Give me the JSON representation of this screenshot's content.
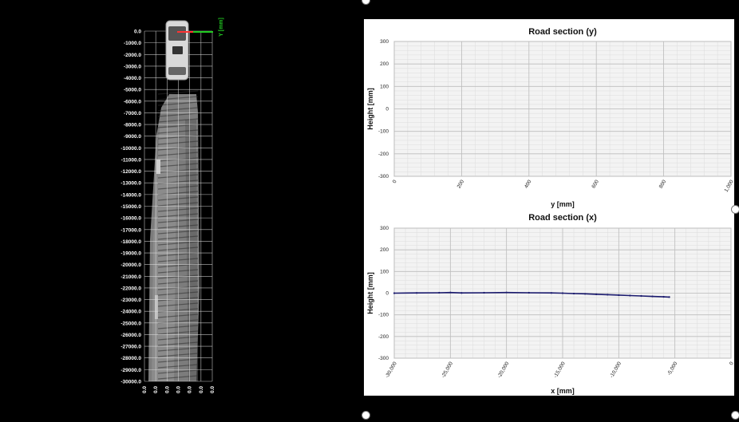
{
  "scan_view": {
    "axis_label": "Y [mm]",
    "row_labels": [
      "0.0",
      "-1000.0",
      "-2000.0",
      "-3000.0",
      "-4000.0",
      "-5000.0",
      "-6000.0",
      "-7000.0",
      "-8000.0",
      "-9000.0",
      "-10000.0",
      "-11000.0",
      "-12000.0",
      "-13000.0",
      "-14000.0",
      "-15000.0",
      "-16000.0",
      "-17000.0",
      "-18000.0",
      "-19000.0",
      "-20000.0",
      "-21000.0",
      "-22000.0",
      "-23000.0",
      "-24000.0",
      "-25000.0",
      "-26000.0",
      "-27000.0",
      "-28000.0",
      "-29000.0",
      "-30000.0"
    ],
    "col_labels": [
      "0.0",
      "0.0",
      "0.0",
      "0.0",
      "0.0",
      "0.0",
      "0.0"
    ],
    "grid_color": "#e0e0e0",
    "axis_y_color": "#22cc22",
    "axis_x_color": "#ff3333",
    "icon": "vehicle-icon"
  },
  "chart_data": [
    {
      "type": "scatter",
      "title": "Road section (y)",
      "xlabel": "y [mm]",
      "ylabel": "Height [mm]",
      "xlim": [
        0,
        1000
      ],
      "ylim": [
        -300,
        300
      ],
      "x_ticks": [
        0,
        200,
        400,
        600,
        800,
        1000
      ],
      "x_tick_labels": [
        "0",
        "200",
        "400",
        "600",
        "800",
        "1,000"
      ],
      "y_ticks": [
        300,
        200,
        100,
        0,
        -100,
        -200,
        -300
      ],
      "y_tick_labels": [
        "300",
        "200",
        "100",
        "0",
        "-100",
        "-200",
        "-300"
      ],
      "grid": true,
      "series": [
        {
          "x": [],
          "y": []
        }
      ]
    },
    {
      "type": "line",
      "title": "Road section (x)",
      "xlabel": "x [mm]",
      "ylabel": "Height [mm]",
      "xlim": [
        -30000,
        0
      ],
      "ylim": [
        -300,
        300
      ],
      "x_ticks": [
        -30000,
        -25000,
        -20000,
        -15000,
        -10000,
        -5000,
        0
      ],
      "x_tick_labels": [
        "-30,000",
        "-25,000",
        "-20,000",
        "-15,000",
        "-10,000",
        "-5,000",
        "0"
      ],
      "y_ticks": [
        300,
        200,
        100,
        0,
        -100,
        -200,
        -300
      ],
      "y_tick_labels": [
        "300",
        "200",
        "100",
        "0",
        "-100",
        "-200",
        "-300"
      ],
      "grid": true,
      "series_color": "#1a1a6e",
      "series": [
        {
          "x": [
            -30000,
            -28000,
            -26000,
            -25000,
            -24000,
            -22000,
            -20000,
            -18000,
            -16000,
            -15000,
            -14000,
            -13000,
            -12000,
            -11000,
            -10000,
            -9000,
            -8000,
            -7000,
            -6000,
            -5500
          ],
          "y": [
            0,
            1,
            2,
            3,
            1,
            2,
            3,
            2,
            1,
            0,
            -2,
            -3,
            -5,
            -7,
            -9,
            -11,
            -13,
            -15,
            -17,
            -18
          ]
        }
      ]
    }
  ]
}
